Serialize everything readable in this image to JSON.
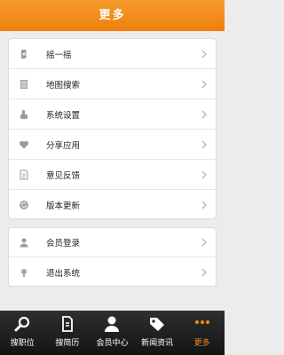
{
  "header": {
    "title": "更多"
  },
  "menu_group_1": [
    {
      "label": "摇一摇",
      "icon": "shake-icon"
    },
    {
      "label": "地图搜索",
      "icon": "map-icon"
    },
    {
      "label": "系统设置",
      "icon": "settings-icon"
    },
    {
      "label": "分享应用",
      "icon": "heart-icon"
    },
    {
      "label": "意见反馈",
      "icon": "feedback-icon"
    },
    {
      "label": "版本更新",
      "icon": "update-icon"
    }
  ],
  "menu_group_2": [
    {
      "label": "会员登录",
      "icon": "user-icon"
    },
    {
      "label": "退出系统",
      "icon": "exit-icon"
    }
  ],
  "tabbar": [
    {
      "label": "搜职位",
      "icon": "search-icon"
    },
    {
      "label": "搜简历",
      "icon": "resume-icon"
    },
    {
      "label": "会员中心",
      "icon": "member-icon"
    },
    {
      "label": "新闻资讯",
      "icon": "news-tag-icon"
    },
    {
      "label": "更多",
      "icon": "more-dots-icon",
      "active": true
    }
  ],
  "colors": {
    "accent": "#ef7f0c",
    "tabbar_bg": "#1f1f1f"
  }
}
